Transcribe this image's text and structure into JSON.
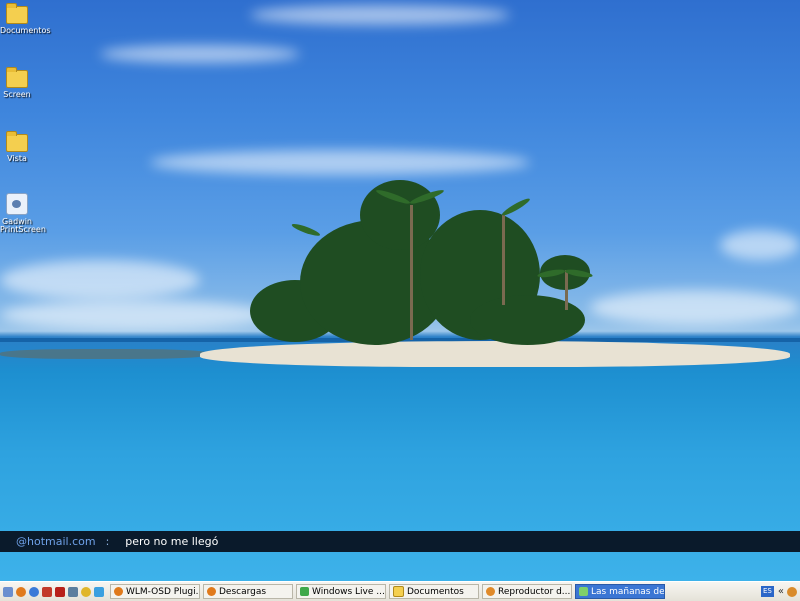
{
  "desktop": {
    "icons": [
      {
        "label": "Documentos",
        "icon": "folder-icon"
      },
      {
        "label": "Screen",
        "icon": "folder-icon"
      },
      {
        "label": "Vista",
        "icon": "folder-icon"
      },
      {
        "label": "Gadwin PrintScreen",
        "icon": "printscreen-app-icon"
      }
    ]
  },
  "notification": {
    "sender": "@hotmail.com",
    "separator": ":",
    "message": "pero no me llegó"
  },
  "taskbar": {
    "quick_launch": [
      "desktop-icon",
      "firefox-icon",
      "ie-icon",
      "media-icon",
      "filezilla-icon",
      "window-icon",
      "chrome-icon",
      "messenger-icon"
    ],
    "tasks": [
      {
        "label": "WLM-OSD Plugi...",
        "icon": "firefox-icon",
        "active": false
      },
      {
        "label": "Descargas",
        "icon": "firefox-icon",
        "active": false
      },
      {
        "label": "Windows Live ...",
        "icon": "messenger-icon",
        "active": false
      },
      {
        "label": "Documentos",
        "icon": "folder-icon",
        "active": false
      },
      {
        "label": "Reproductor d...",
        "icon": "media-player-icon",
        "active": false
      },
      {
        "label": "Las mañanas de...",
        "icon": "messenger-icon",
        "active": true
      }
    ],
    "tray": {
      "language": "ES",
      "expand": "«"
    }
  },
  "colors": {
    "taskbar_active": "#3b76d4",
    "notification_bg": "#0a1a2b",
    "sender_text": "#6fa1e8"
  }
}
